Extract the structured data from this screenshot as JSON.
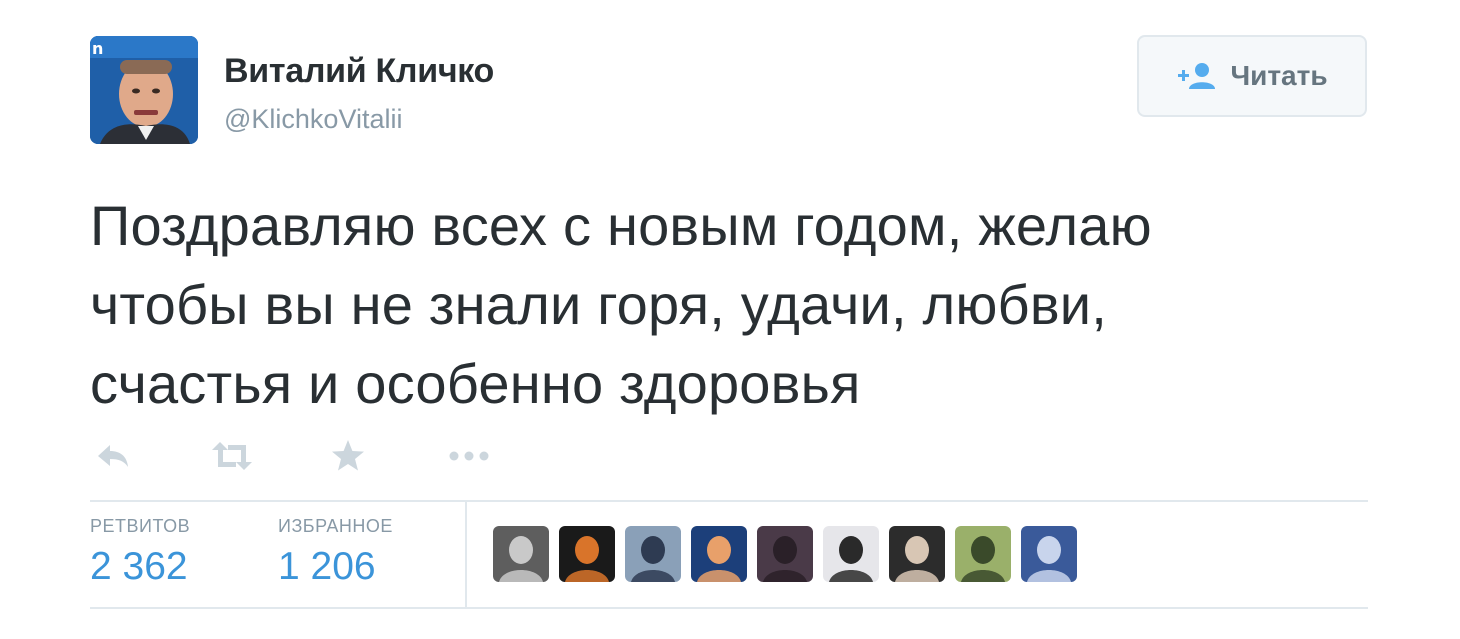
{
  "author": {
    "display_name": "Виталий Кличко",
    "handle": "@KlichkoVitalii"
  },
  "follow_button": {
    "label": "Читать",
    "icon": "follow-person-plus-icon"
  },
  "tweet": {
    "lines": [
      "Поздравляю всех с новым годом, желаю",
      "чтобы вы не знали горя, удачи, любви,",
      "счастья и особенно здоровья"
    ]
  },
  "actions": [
    {
      "name": "reply",
      "icon": "reply-icon"
    },
    {
      "name": "retweet",
      "icon": "retweet-icon"
    },
    {
      "name": "favorite",
      "icon": "star-icon"
    },
    {
      "name": "more",
      "icon": "more-dots-icon"
    }
  ],
  "stats": {
    "retweets_label": "РЕТВИТОВ",
    "retweets_value": "2 362",
    "favorites_label": "ИЗБРАННОЕ",
    "favorites_value": "1 206"
  },
  "colors": {
    "text": "#292f33",
    "muted": "#8899a6",
    "link_blue": "#3b94d9",
    "border": "#e1e8ed",
    "icon_gray": "#ccd6dd"
  },
  "favorited_by_avatars": [
    {
      "bg": "#5e5e5e",
      "fg": "#c9c9c9"
    },
    {
      "bg": "#1a1a1a",
      "fg": "#d9742a"
    },
    {
      "bg": "#8aa0b8",
      "fg": "#2e3b52"
    },
    {
      "bg": "#1c3f7a",
      "fg": "#e8a06a"
    },
    {
      "bg": "#4a3a48",
      "fg": "#2a2028"
    },
    {
      "bg": "#e6e6ea",
      "fg": "#2a2a2a"
    },
    {
      "bg": "#2c2c2c",
      "fg": "#d8c6b4"
    },
    {
      "bg": "#9ab06a",
      "fg": "#3a4a2a"
    },
    {
      "bg": "#3a5a9a",
      "fg": "#c8d4ec"
    }
  ]
}
